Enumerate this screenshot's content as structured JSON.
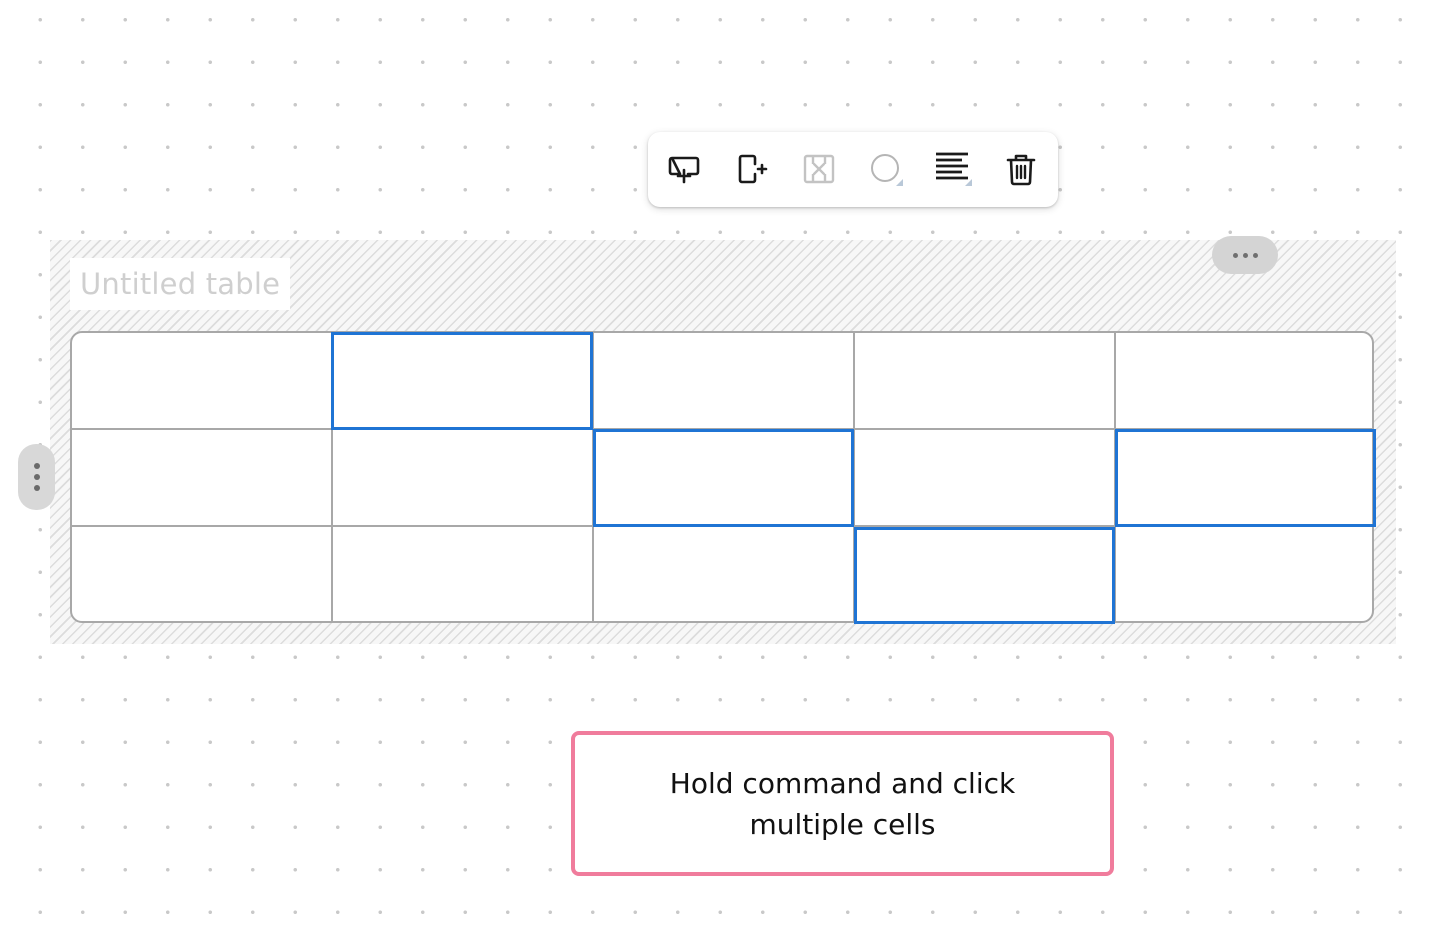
{
  "toolbar": {
    "buttons": [
      {
        "icon": "add-row-below-icon",
        "enabled": true
      },
      {
        "icon": "add-column-right-icon",
        "enabled": true
      },
      {
        "icon": "merge-cells-icon",
        "enabled": false
      },
      {
        "icon": "cell-fill-color-icon",
        "enabled": true
      },
      {
        "icon": "text-align-left-icon",
        "enabled": true
      },
      {
        "icon": "trash-icon",
        "enabled": true
      }
    ]
  },
  "table": {
    "title_placeholder": "Untitled table",
    "rows": 3,
    "columns": 5,
    "selected_cells": [
      [
        0,
        1
      ],
      [
        1,
        2
      ],
      [
        1,
        4
      ],
      [
        2,
        3
      ]
    ],
    "selection_color": "#1f74d4"
  },
  "hint": {
    "text": "Hold command and click multiple cells",
    "border_color": "#f07c9c"
  }
}
